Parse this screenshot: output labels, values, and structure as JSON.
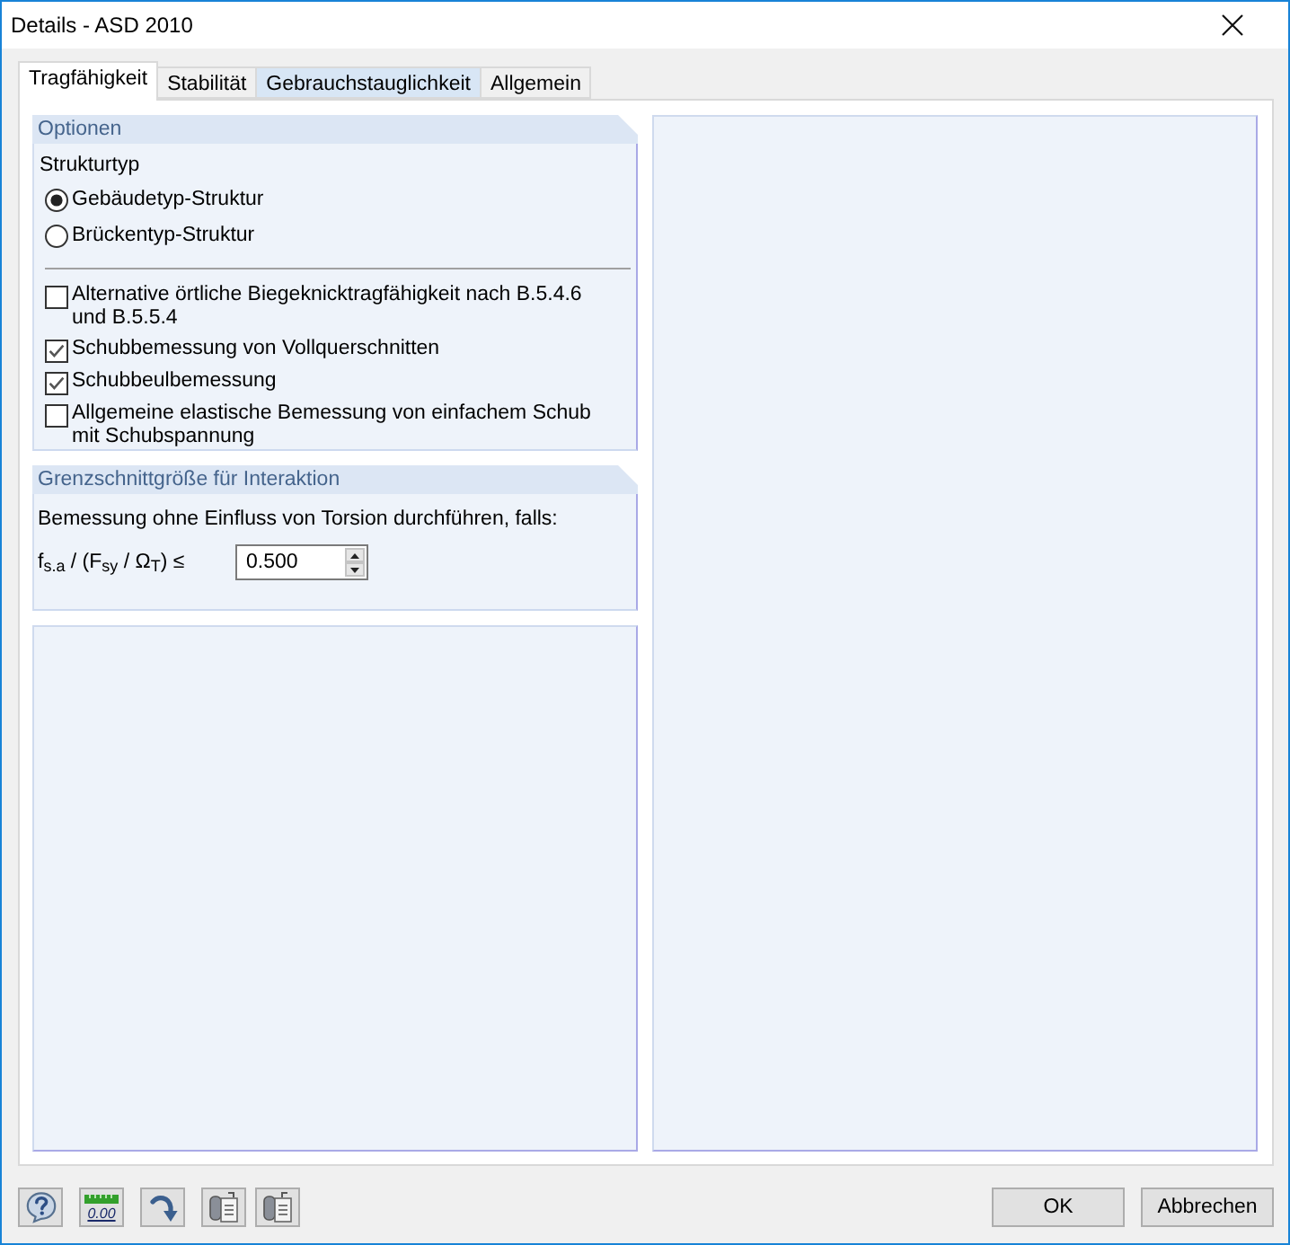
{
  "window": {
    "title": "Details - ASD 2010"
  },
  "tabs": [
    {
      "label": "Tragfähigkeit",
      "selected": true,
      "hovered": false
    },
    {
      "label": "Stabilität",
      "selected": false,
      "hovered": false
    },
    {
      "label": "Gebrauchstauglichkeit",
      "selected": false,
      "hovered": true
    },
    {
      "label": "Allgemein",
      "selected": false,
      "hovered": false
    }
  ],
  "options": {
    "title": "Optionen",
    "structure_type_label": "Strukturtyp",
    "structure_types": [
      {
        "label": "Gebäudetyp-Struktur",
        "selected": true
      },
      {
        "label": "Brückentyp-Struktur",
        "selected": false
      }
    ],
    "checkboxes": [
      {
        "label": "Alternative örtliche Biegeknicktragfähigkeit nach B.5.4.6\nund B.5.5.4",
        "checked": false
      },
      {
        "label": "Schubbemessung von Vollquerschnitten",
        "checked": true
      },
      {
        "label": "Schubbeulbemessung",
        "checked": true
      },
      {
        "label": "Allgemeine elastische Bemessung von einfachem Schub\nmit Schubspannung",
        "checked": false
      }
    ]
  },
  "interaction": {
    "title": "Grenzschnittgröße für Interaktion",
    "description": "Bemessung ohne Einfluss von Torsion durchführen, falls:",
    "condition_label": "f$_{s.a}$ / (F$_{sy}$ / Ω$_{T}$) ≤",
    "value": "0.500"
  },
  "toolbar": [
    {
      "kind": "help"
    },
    {
      "kind": "decimals",
      "text": "0.00"
    },
    {
      "kind": "redo"
    },
    {
      "kind": "export"
    },
    {
      "kind": "import"
    }
  ],
  "buttons": [
    "OK",
    "Abbrechen"
  ]
}
